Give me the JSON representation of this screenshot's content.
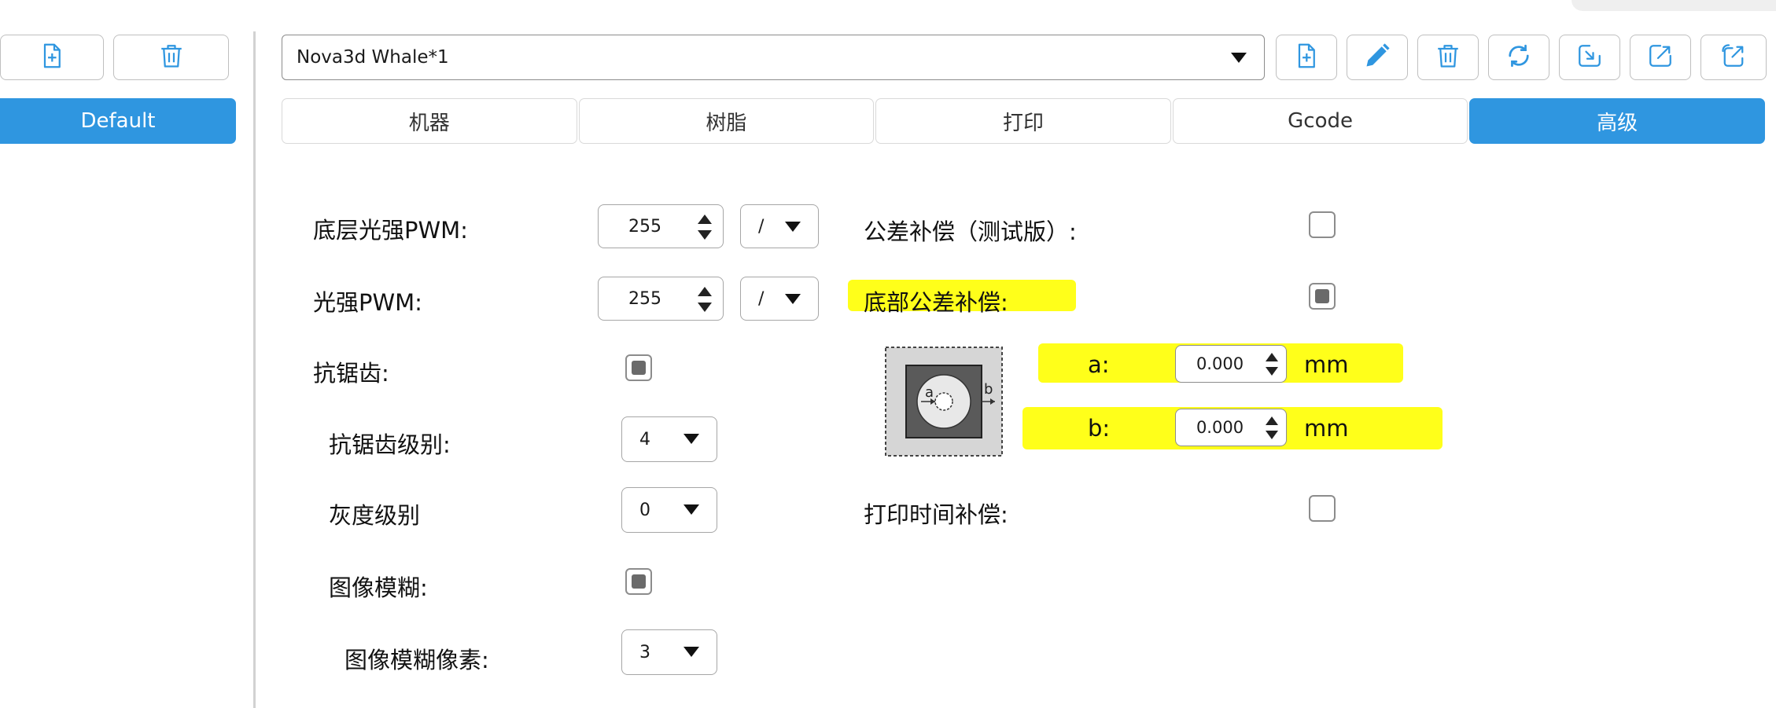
{
  "sidebar": {
    "add_icon": "file-add-icon",
    "delete_icon": "trash-icon",
    "profiles": [
      "Default"
    ]
  },
  "profile_select": {
    "value": "Nova3d Whale*1"
  },
  "toolbar_icons": [
    "file-add-icon",
    "pencil-icon",
    "trash-icon",
    "refresh-icon",
    "import-icon",
    "export-icon",
    "export-all-icon"
  ],
  "tabs": [
    "机器",
    "树脂",
    "打印",
    "Gcode",
    "高级"
  ],
  "active_tab": "高级",
  "left_settings": {
    "bottom_pwm": {
      "label": "底层光强PWM:",
      "value": "255",
      "unit_option": "/"
    },
    "pwm": {
      "label": "光强PWM:",
      "value": "255",
      "unit_option": "/"
    },
    "antialias": {
      "label": "抗锯齿:",
      "checked": true
    },
    "antialias_level": {
      "label": "抗锯齿级别:",
      "value": "4"
    },
    "gray_level": {
      "label": "灰度级别",
      "value": "0"
    },
    "image_blur": {
      "label": "图像模糊:",
      "checked": true
    },
    "blur_pixels": {
      "label": "图像模糊像素:",
      "value": "3"
    }
  },
  "right_settings": {
    "tolerance_comp": {
      "label": "公差补偿（测试版）:",
      "checked": false
    },
    "bottom_tolerance_comp": {
      "label": "底部公差补偿:",
      "checked": true
    },
    "diagram": {
      "label_a": "a",
      "label_b": "b"
    },
    "a": {
      "label": "a:",
      "value": "0.000",
      "unit": "mm"
    },
    "b": {
      "label": "b:",
      "value": "0.000",
      "unit": "mm"
    },
    "print_time_comp": {
      "label": "打印时间补偿:",
      "checked": false
    }
  },
  "colors": {
    "accent": "#2f96e0",
    "highlight": "#ffff1a"
  }
}
